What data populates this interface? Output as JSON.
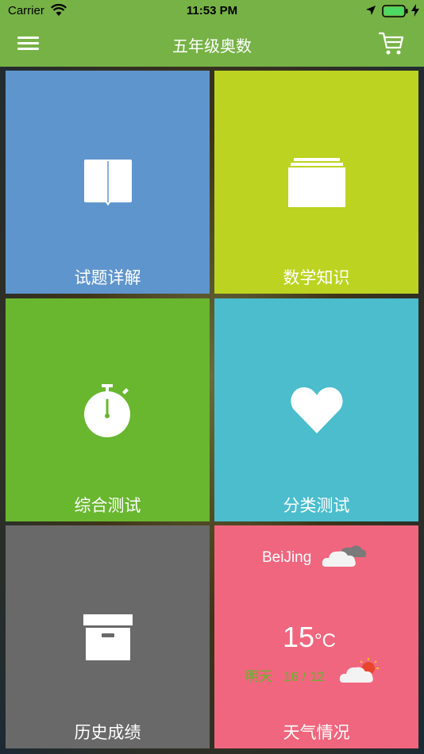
{
  "status_bar": {
    "carrier": "Carrier",
    "time": "11:53 PM",
    "icons": [
      "wifi-icon",
      "location-icon",
      "battery-icon",
      "charging-icon"
    ],
    "battery_level": 1.0
  },
  "header": {
    "title": "五年级奥数",
    "menu_icon": "hamburger-icon",
    "cart_icon": "cart-icon",
    "background_color": "#77b246"
  },
  "tiles": [
    {
      "label": "试题详解",
      "icon": "book-icon",
      "color": "#5f95cd"
    },
    {
      "label": "数学知识",
      "icon": "folder-stack-icon",
      "color": "#bcd321"
    },
    {
      "label": "综合测试",
      "icon": "stopwatch-icon",
      "color": "#68b72f"
    },
    {
      "label": "分类测试",
      "icon": "heart-icon",
      "color": "#4bbdcd"
    },
    {
      "label": "历史成绩",
      "icon": "archive-box-icon",
      "color": "#696969"
    },
    {
      "label": "天气情况",
      "icon": "weather-icon",
      "color": "#f0667e"
    }
  ],
  "weather": {
    "city": "BeiJing",
    "temperature": "15",
    "unit": "°C",
    "tomorrow_label": "明天",
    "tomorrow_range": "16 / 12",
    "today_icon": "cloudy-icon",
    "tomorrow_icon": "partly-sunny-icon",
    "tomorrow_color": "#5fb82a"
  }
}
